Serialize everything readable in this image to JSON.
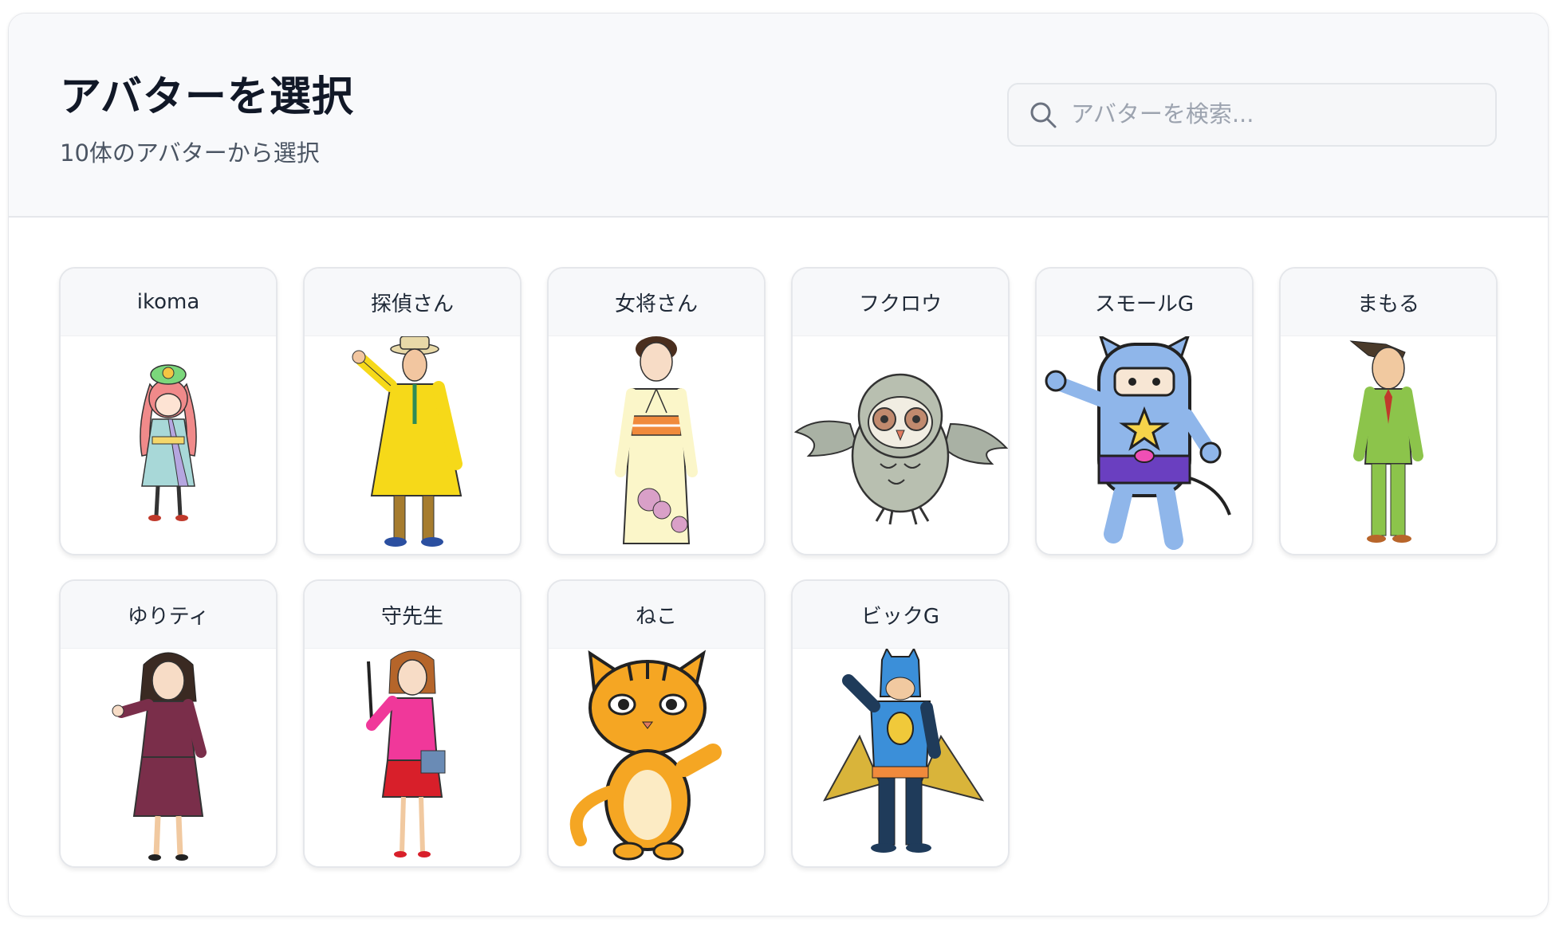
{
  "header": {
    "title": "アバターを選択",
    "subtitle": "10体のアバターから選択"
  },
  "search": {
    "placeholder": "アバターを検索...",
    "icon": "search-icon"
  },
  "avatars": [
    {
      "name": "ikoma"
    },
    {
      "name": "探偵さん"
    },
    {
      "name": "女将さん"
    },
    {
      "name": "フクロウ"
    },
    {
      "name": "スモールG"
    },
    {
      "name": "まもる"
    },
    {
      "name": "ゆりティ"
    },
    {
      "name": "守先生"
    },
    {
      "name": "ねこ"
    },
    {
      "name": "ビックG"
    }
  ]
}
